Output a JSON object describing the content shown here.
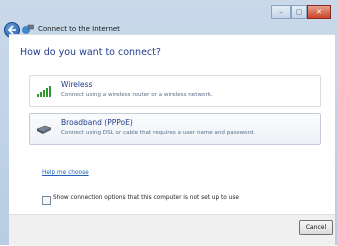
{
  "window": {
    "title": "Connect to the Internet",
    "controls": {
      "minimize": "–",
      "maximize": "▢",
      "close": "✕"
    }
  },
  "main": {
    "heading": "How do you want to connect?",
    "options": [
      {
        "icon": "wireless-signal-icon",
        "title": "Wireless",
        "description": "Connect using a wireless router or a wireless network."
      },
      {
        "icon": "broadband-modem-icon",
        "title": "Broadband (PPPoE)",
        "description": "Connect using DSL or cable that requires a user name and password."
      }
    ],
    "checkbox": {
      "label": "Show connection options that this computer is not set up to use",
      "checked": false
    },
    "help_link": "Help me choose"
  },
  "footer": {
    "cancel_label": "Cancel"
  }
}
